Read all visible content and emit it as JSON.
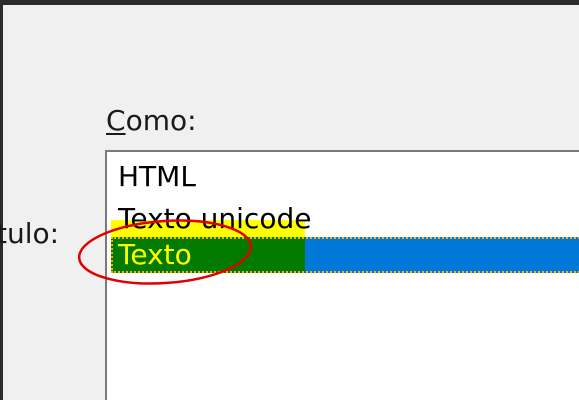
{
  "dialog": {
    "como_label_mnemonic": "C",
    "como_label_rest": "omo:",
    "titulo_label": "tulo:"
  },
  "list": {
    "items": [
      {
        "label": "HTML",
        "selected": false
      },
      {
        "label": "Texto unicode",
        "selected": false
      },
      {
        "label": "Texto",
        "selected": true
      }
    ]
  },
  "colors": {
    "selection": "#0078d7",
    "highlight_green": "#007a00",
    "highlight_yellow": "#ffff00",
    "annotation_circle": "#e00000"
  }
}
